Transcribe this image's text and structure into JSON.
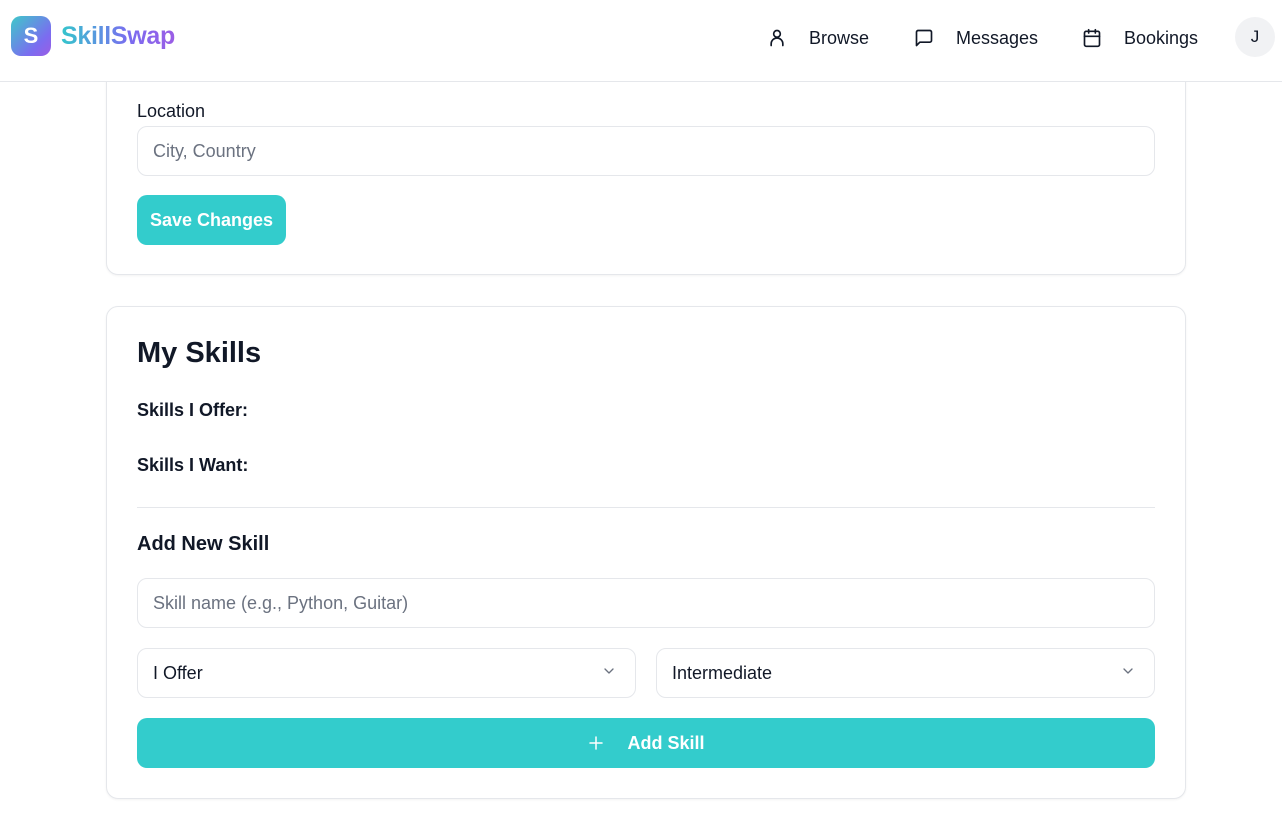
{
  "header": {
    "logo_letter": "S",
    "app_name": "SkillSwap",
    "nav": [
      {
        "label": "Browse",
        "icon": "user-icon"
      },
      {
        "label": "Messages",
        "icon": "message-square-icon"
      },
      {
        "label": "Bookings",
        "icon": "calendar-icon"
      }
    ],
    "avatar_initial": "J"
  },
  "profile_form": {
    "location_label": "Location",
    "location_placeholder": "City, Country",
    "location_value": "",
    "save_label": "Save Changes"
  },
  "skills": {
    "title": "My Skills",
    "offer_label": "Skills I Offer:",
    "want_label": "Skills I Want:",
    "add_title": "Add New Skill",
    "skill_name_placeholder": "Skill name (e.g., Python, Guitar)",
    "type_selected": "I Offer",
    "level_selected": "Intermediate",
    "add_button_label": "Add Skill"
  },
  "colors": {
    "accent": "#33cccc",
    "brand_gradient_start": "#34c6cc",
    "brand_gradient_end": "#9b5de5",
    "border": "#e5e7eb"
  }
}
